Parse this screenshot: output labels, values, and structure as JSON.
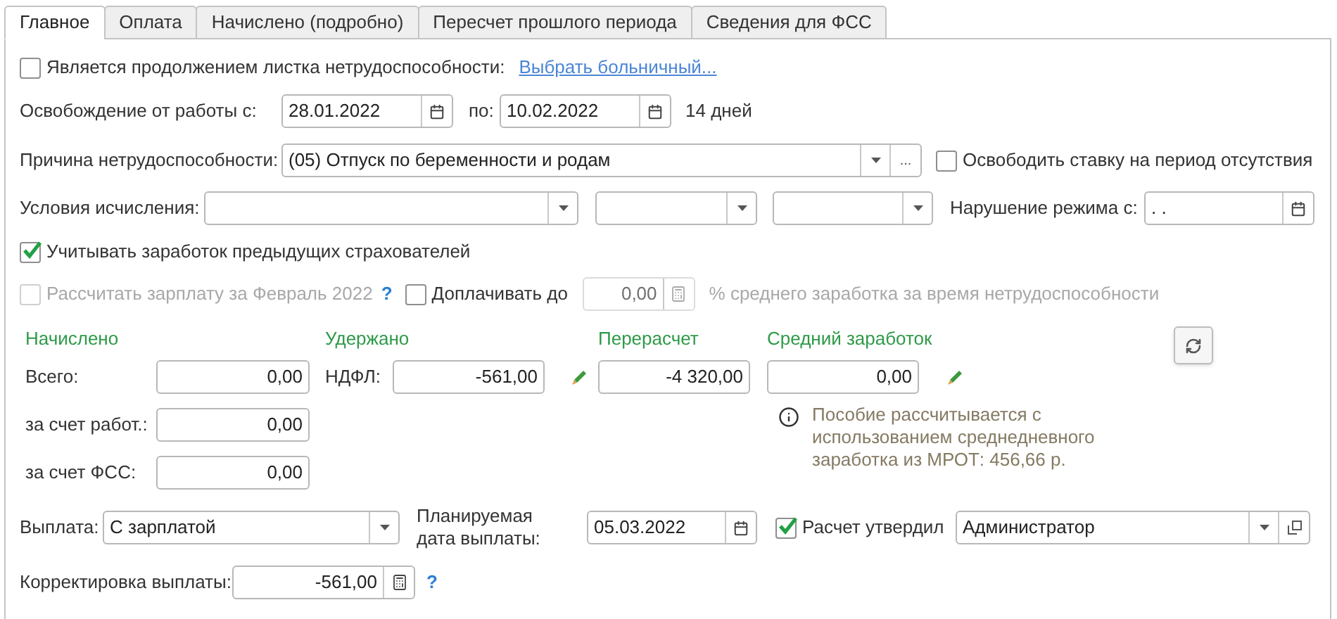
{
  "tabs": [
    {
      "label": "Главное",
      "selected": true
    },
    {
      "label": "Оплата",
      "selected": false
    },
    {
      "label": "Начислено (подробно)",
      "selected": false
    },
    {
      "label": "Пересчет прошлого периода",
      "selected": false
    },
    {
      "label": "Сведения для ФСС",
      "selected": false
    }
  ],
  "continuation": {
    "checked": false,
    "label": "Является продолжением листка нетрудоспособности:",
    "link": "Выбрать больничный..."
  },
  "release": {
    "label": "Освобождение от работы с:",
    "from": "28.01.2022",
    "to_label": "по:",
    "to": "10.02.2022",
    "days": "14 дней"
  },
  "reason": {
    "label": "Причина нетрудоспособности:",
    "value": "(05) Отпуск по беременности и родам",
    "more": "...",
    "free_rate": {
      "checked": false,
      "label": "Освободить ставку на период отсутствия"
    }
  },
  "conditions": {
    "label": "Условия исчисления:",
    "violation_label": "Нарушение режима с:",
    "violation_date": ". ."
  },
  "prev_insurers": {
    "checked": true,
    "label": "Учитывать заработок предыдущих страхователей"
  },
  "calc_salary": {
    "checked": false,
    "disabled": true,
    "label": "Рассчитать зарплату за Февраль 2022",
    "help": "?"
  },
  "topup": {
    "checked": false,
    "label": "Доплачивать до",
    "value": "0,00",
    "disabled": true,
    "suffix": "% среднего заработка за время нетрудоспособности"
  },
  "accrued": {
    "title": "Начислено",
    "rows": [
      {
        "label": "Всего:",
        "value": "0,00"
      },
      {
        "label": "за счет работ.:",
        "value": "0,00"
      },
      {
        "label": "за счет ФСС:",
        "value": "0,00"
      }
    ]
  },
  "withheld": {
    "title": "Удержано",
    "label": "НДФЛ:",
    "value": "-561,00"
  },
  "recalc": {
    "title": "Перерасчет",
    "value": "-4 320,00"
  },
  "average": {
    "title": "Средний заработок",
    "value": "0,00"
  },
  "info": "Пособие рассчитывается с использованием среднедневного заработка из МРОТ: 456,66 р.",
  "payment": {
    "label": "Выплата:",
    "value": "С зарплатой",
    "date_label": "Планируемая дата выплаты:",
    "date": "05.03.2022",
    "approved": {
      "checked": true,
      "label": "Расчет утвердил",
      "value": "Администратор"
    }
  },
  "correction": {
    "label": "Корректировка выплаты:",
    "value": "-561,00",
    "help": "?"
  }
}
